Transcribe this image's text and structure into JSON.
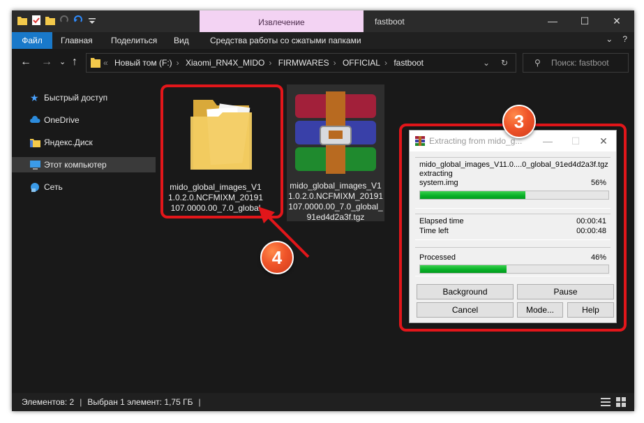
{
  "window": {
    "context_tab": "Извлечение",
    "title": "fastboot",
    "controls": {
      "minimize": "—",
      "maximize": "☐",
      "close": "✕"
    }
  },
  "ribbon": {
    "tabs": [
      "Файл",
      "Главная",
      "Поделиться",
      "Вид",
      "Средства работы со сжатыми папками"
    ],
    "file_tab_color": "#1979ca"
  },
  "address": {
    "crumbs": [
      "Новый том (F:)",
      "Xiaomi_RN4X_MIDO",
      "FIRMWARES",
      "OFFICIAL",
      "fastboot"
    ],
    "search_placeholder": "Поиск: fastboot"
  },
  "nav_pane": {
    "items": [
      {
        "label": "Быстрый доступ",
        "icon": "star-icon",
        "selected": false
      },
      {
        "label": "OneDrive",
        "icon": "cloud-icon",
        "selected": false
      },
      {
        "label": "Яндекс.Диск",
        "icon": "yandex-disk-icon",
        "selected": false
      },
      {
        "label": "Этот компьютер",
        "icon": "computer-icon",
        "selected": true
      },
      {
        "label": "Сеть",
        "icon": "network-icon",
        "selected": false
      }
    ]
  },
  "files": [
    {
      "name": "mido_global_images_V11.0.2.0.NCFMIXM_20191107.0000.00_7.0_global",
      "icon": "folder-icon"
    },
    {
      "name": "mido_global_images_V11.0.2.0.NCFMIXM_20191107.0000.00_7.0_global_91ed4d2a3f.tgz",
      "icon": "winrar-archive-icon"
    }
  ],
  "status_bar": {
    "items_count": "Элементов: 2",
    "selected": "Выбран 1 элемент: 1,75 ГБ"
  },
  "annotations": {
    "badge_3": "3",
    "badge_4": "4",
    "color": "#e2161a"
  },
  "dialog": {
    "title": "Extracting from mido_g...",
    "archive": "mido_global_images_V11.0....0_global_91ed4d2a3f.tgz",
    "action": "extracting",
    "current_file": "system.img",
    "file_percent": "56%",
    "file_progress": 0.56,
    "elapsed_label": "Elapsed time",
    "elapsed_value": "00:00:41",
    "left_label": "Time left",
    "left_value": "00:00:48",
    "processed_label": "Processed",
    "processed_percent": "46%",
    "processed_progress": 0.46,
    "buttons": {
      "background": "Background",
      "pause": "Pause",
      "cancel": "Cancel",
      "mode": "Mode...",
      "help": "Help"
    }
  }
}
